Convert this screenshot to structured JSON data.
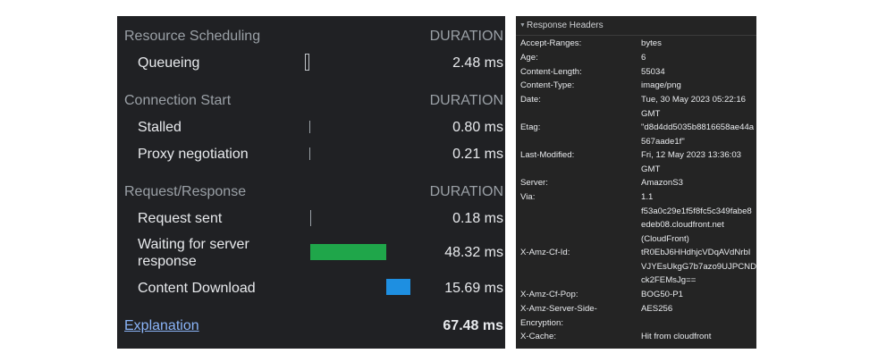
{
  "timing": {
    "sections": [
      {
        "title": "Resource Scheduling",
        "duration_header": "DURATION"
      },
      {
        "title": "Connection Start",
        "duration_header": "DURATION"
      },
      {
        "title": "Request/Response",
        "duration_header": "DURATION"
      }
    ],
    "rows": [
      {
        "label": "Queueing",
        "value": "2.48 ms"
      },
      {
        "label": "Stalled",
        "value": "0.80 ms"
      },
      {
        "label": "Proxy negotiation",
        "value": "0.21 ms"
      },
      {
        "label": "Request sent",
        "value": "0.18 ms"
      },
      {
        "label": "Waiting for server response",
        "value": "48.32 ms"
      },
      {
        "label": "Content Download",
        "value": "15.69 ms"
      }
    ],
    "explanation_link": "Explanation",
    "total": "67.48 ms",
    "colors": {
      "waiting_bar": "#1fa64a",
      "download_bar": "#1e8fe1",
      "link": "#8ab4f8"
    }
  },
  "headers": {
    "title": "Response Headers",
    "items": [
      {
        "key": "Accept-Ranges:",
        "value": "bytes"
      },
      {
        "key": "Age:",
        "value": "6"
      },
      {
        "key": "Content-Length:",
        "value": "55034"
      },
      {
        "key": "Content-Type:",
        "value": "image/png"
      },
      {
        "key": "Date:",
        "value": "Tue, 30 May 2023 05:22:16\nGMT"
      },
      {
        "key": "Etag:",
        "value": "\"d8d4dd5035b8816658ae44a\n567aade1f\""
      },
      {
        "key": "Last-Modified:",
        "value": "Fri, 12 May 2023 13:36:03\nGMT"
      },
      {
        "key": "Server:",
        "value": "AmazonS3"
      },
      {
        "key": "Via:",
        "value": "1.1\nf53a0c29e1f5f8fc5c349fabe8\nedeb08.cloudfront.net\n(CloudFront)"
      },
      {
        "key": "X-Amz-Cf-Id:",
        "value": "tR0EbJ6HHdhjcVDqAVdNrbI\nVJYEsUkgG7b7azo9UJPCND\nck2FEMsJg=="
      },
      {
        "key": "X-Amz-Cf-Pop:",
        "value": "BOG50-P1"
      },
      {
        "key": "X-Amz-Server-Side-\nEncryption:",
        "value": "AES256"
      },
      {
        "key": "X-Cache:",
        "value": "Hit from cloudfront"
      }
    ]
  }
}
